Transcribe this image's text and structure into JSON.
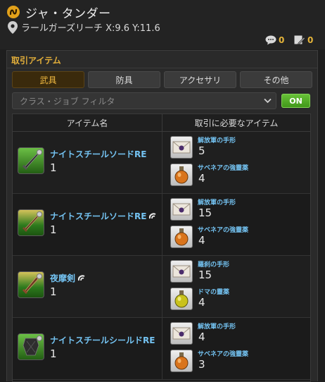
{
  "npc": {
    "name": "ジャ・タンダー",
    "location": "ラールガーズリーチ X:9.6 Y:11.6"
  },
  "counters": {
    "comments": "0",
    "notes": "0"
  },
  "panel": {
    "title": "取引アイテム",
    "tabs": [
      "武具",
      "防具",
      "アクセサリ",
      "その他"
    ],
    "active_tab": "武具",
    "filter_placeholder": "クラス・ジョブ フィルタ",
    "on_label": "ON"
  },
  "table": {
    "headers": [
      "アイテム名",
      "取引に必要なアイテム"
    ],
    "rows": [
      {
        "name": "ナイトスチールソードRE",
        "qty": "1",
        "hq": false,
        "icon": "sword-icon",
        "req": [
          {
            "name": "解放軍の手形",
            "qty": "5",
            "icon": "letter-icon"
          },
          {
            "name": "サベネアの強靈薬",
            "qty": "4",
            "icon": "potion-icon"
          }
        ]
      },
      {
        "name": "ナイトスチールソードRE",
        "qty": "1",
        "hq": true,
        "icon": "sword-icon",
        "req": [
          {
            "name": "解放軍の手形",
            "qty": "15",
            "icon": "letter-icon"
          },
          {
            "name": "サベネアの強靈薬",
            "qty": "4",
            "icon": "potion-icon"
          }
        ]
      },
      {
        "name": "夜摩剣",
        "qty": "1",
        "hq": true,
        "icon": "sword-icon",
        "req": [
          {
            "name": "羅刹の手形",
            "qty": "15",
            "icon": "letter-icon"
          },
          {
            "name": "ドマの靈薬",
            "qty": "4",
            "icon": "potion-icon"
          }
        ]
      },
      {
        "name": "ナイトスチールシールドRE",
        "qty": "1",
        "hq": false,
        "icon": "shield-icon",
        "req": [
          {
            "name": "解放軍の手形",
            "qty": "4",
            "icon": "letter-icon"
          },
          {
            "name": "サベネアの強靈薬",
            "qty": "3",
            "icon": "potion-icon"
          }
        ]
      }
    ]
  },
  "colors": {
    "accent": "#e2ae3a",
    "link": "#74c3f2",
    "on_green": "#4fae25"
  }
}
